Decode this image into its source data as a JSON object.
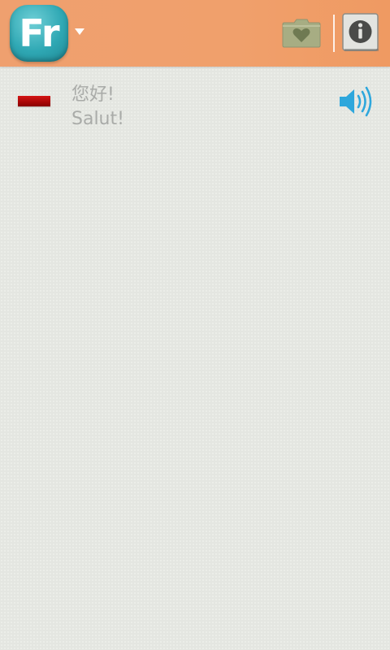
{
  "header": {
    "logo_text": "Fr",
    "dropdown_icon": "chevron-down-icon",
    "favorites_icon": "heart-folder-icon",
    "info_icon": "info-icon",
    "bar_color": "#f0a06c",
    "logo_color": "#2fa8b4"
  },
  "phrases": [
    {
      "flag_icon": "flag-icon",
      "source": "您好!",
      "target": "Salut!",
      "audio_icon": "speaker-icon",
      "audio_color": "#2ea7dc"
    }
  ]
}
